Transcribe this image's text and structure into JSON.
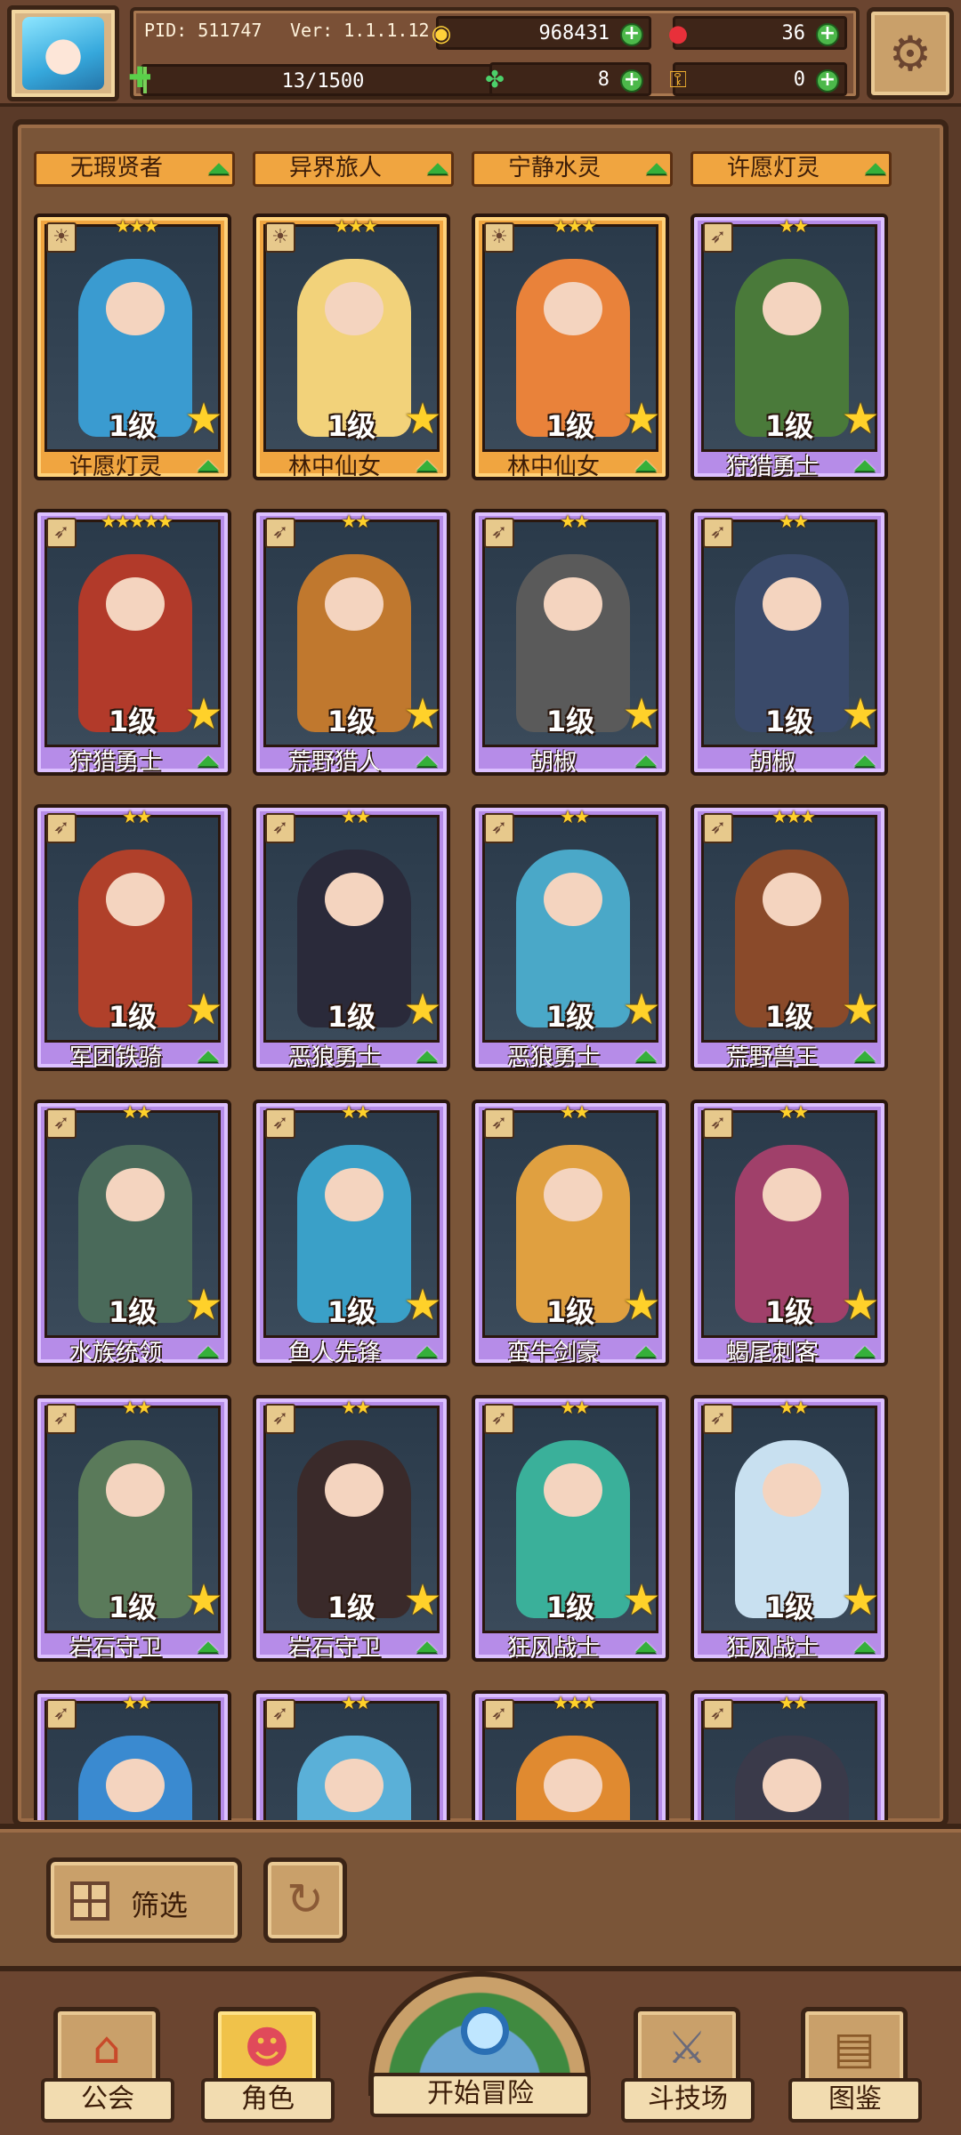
{
  "header": {
    "pid": "PID: 511747",
    "version": "Ver: 1.1.1.12",
    "gold": "968431",
    "gems": "36",
    "clover": "8",
    "keys": "0",
    "capacity_text": "13/1500",
    "capacity_fraction": 0.0087
  },
  "top_labels": [
    "无瑕贤者",
    "异界旅人",
    "宁静水灵",
    "许愿灯灵"
  ],
  "cards": [
    {
      "name": "许愿灯灵",
      "level": "1级",
      "stars": 3,
      "frame": "gold",
      "tint": "#3a9bd0"
    },
    {
      "name": "林中仙女",
      "level": "1级",
      "stars": 3,
      "frame": "gold",
      "tint": "#f2d27a"
    },
    {
      "name": "林中仙女",
      "level": "1级",
      "stars": 3,
      "frame": "gold",
      "tint": "#e9823a"
    },
    {
      "name": "狩猎勇士",
      "level": "1级",
      "stars": 2,
      "frame": "purple",
      "tint": "#4a7a3a"
    },
    {
      "name": "狩猎勇士",
      "level": "1级",
      "stars": 5,
      "frame": "purple",
      "tint": "#b23a2a"
    },
    {
      "name": "荒野猎人",
      "level": "1级",
      "stars": 2,
      "frame": "purple",
      "tint": "#c0782e"
    },
    {
      "name": "胡椒",
      "level": "1级",
      "stars": 2,
      "frame": "purple",
      "tint": "#5a5a5a"
    },
    {
      "name": "胡椒",
      "level": "1级",
      "stars": 2,
      "frame": "purple",
      "tint": "#3a4a6a"
    },
    {
      "name": "军团铁骑",
      "level": "1级",
      "stars": 2,
      "frame": "purple",
      "tint": "#b0402a"
    },
    {
      "name": "恶狼勇士",
      "level": "1级",
      "stars": 2,
      "frame": "purple",
      "tint": "#2a2a3a"
    },
    {
      "name": "恶狼勇士",
      "level": "1级",
      "stars": 2,
      "frame": "purple",
      "tint": "#4aa8c8"
    },
    {
      "name": "荒野兽王",
      "level": "1级",
      "stars": 3,
      "frame": "purple",
      "tint": "#8a4a2a"
    },
    {
      "name": "水族统领",
      "level": "1级",
      "stars": 2,
      "frame": "purple",
      "tint": "#4a6a5a"
    },
    {
      "name": "鱼人先锋",
      "level": "1级",
      "stars": 2,
      "frame": "purple",
      "tint": "#3aa0c8"
    },
    {
      "name": "蛮牛剑豪",
      "level": "1级",
      "stars": 2,
      "frame": "purple",
      "tint": "#e0a040"
    },
    {
      "name": "蝎尾刺客",
      "level": "1级",
      "stars": 2,
      "frame": "purple",
      "tint": "#a0406a"
    },
    {
      "name": "岩石守卫",
      "level": "1级",
      "stars": 2,
      "frame": "purple",
      "tint": "#5a7a5a"
    },
    {
      "name": "岩石守卫",
      "level": "1级",
      "stars": 2,
      "frame": "purple",
      "tint": "#3a2a2a"
    },
    {
      "name": "狂风战士",
      "level": "1级",
      "stars": 2,
      "frame": "purple",
      "tint": "#3ab09a"
    },
    {
      "name": "狂风战士",
      "level": "1级",
      "stars": 2,
      "frame": "purple",
      "tint": "#c8e0f0"
    },
    {
      "name": "",
      "level": "",
      "stars": 2,
      "frame": "purple",
      "tint": "#3a8ad0"
    },
    {
      "name": "",
      "level": "",
      "stars": 2,
      "frame": "purple",
      "tint": "#5ab0d8"
    },
    {
      "name": "",
      "level": "",
      "stars": 3,
      "frame": "purple",
      "tint": "#e08a30"
    },
    {
      "name": "",
      "level": "",
      "stars": 2,
      "frame": "purple",
      "tint": "#3a3a4a"
    }
  ],
  "filter": {
    "label": "筛选"
  },
  "nav": {
    "guild": "公会",
    "character": "角色",
    "adventure": "开始冒险",
    "arena": "斗技场",
    "codex": "图鉴"
  },
  "icons": {
    "gold": "coin-icon",
    "gem": "gem-icon",
    "clover": "clover-icon",
    "key": "key-icon",
    "settings": "gear-icon"
  },
  "colors": {
    "gold_frame": "#f0a540",
    "purple_frame": "#b68ce8",
    "upgrade_arrow": "#35b03a"
  }
}
